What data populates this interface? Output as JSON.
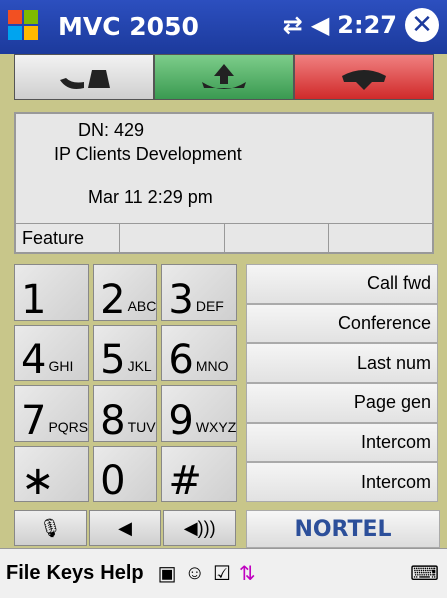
{
  "titlebar": {
    "app_name": "MVC 2050",
    "time": "2:27",
    "status_icons": [
      "connectivity-icon",
      "speaker-icon"
    ],
    "close_label": "✕"
  },
  "call_buttons": [
    {
      "name": "hold-button",
      "icon": "hold-icon"
    },
    {
      "name": "answer-button",
      "icon": "answer-icon"
    },
    {
      "name": "release-button",
      "icon": "release-icon"
    }
  ],
  "display": {
    "dn": "DN:  429",
    "description": "IP Clients Development",
    "date": "Mar 11 2:29 pm",
    "softkeys": [
      "Feature",
      "",
      "",
      ""
    ]
  },
  "keypad": [
    {
      "num": "1",
      "letters": ""
    },
    {
      "num": "2",
      "letters": "ABC"
    },
    {
      "num": "3",
      "letters": "DEF"
    },
    {
      "num": "4",
      "letters": "GHI"
    },
    {
      "num": "5",
      "letters": "JKL"
    },
    {
      "num": "6",
      "letters": "MNO"
    },
    {
      "num": "7",
      "letters": "PQRS"
    },
    {
      "num": "8",
      "letters": "TUV"
    },
    {
      "num": "9",
      "letters": "WXYZ"
    },
    {
      "num": "∗",
      "letters": ""
    },
    {
      "num": "0",
      "letters": ""
    },
    {
      "num": "#",
      "letters": ""
    }
  ],
  "features": [
    "Call fwd",
    "Conference",
    "Last num",
    "Page gen",
    "Intercom",
    "Intercom"
  ],
  "audio_controls": [
    {
      "name": "mute-button",
      "icon": "mic-mute-icon"
    },
    {
      "name": "volume-down-button",
      "icon": "volume-down-icon"
    },
    {
      "name": "volume-up-button",
      "icon": "volume-up-icon"
    }
  ],
  "brand": "NORTEL",
  "menubar": {
    "items": [
      "File",
      "Keys",
      "Help"
    ],
    "icons": [
      "copy-icon",
      "contacts-icon",
      "properties-icon",
      "sync-arrows-icon",
      "keyboard-icon"
    ]
  },
  "colors": {
    "titlebar": "#1c3a9c",
    "phone_body": "#c8c68a",
    "answer": "#3a9a51",
    "release": "#d02a2a",
    "brand": "#2c4f9a"
  }
}
